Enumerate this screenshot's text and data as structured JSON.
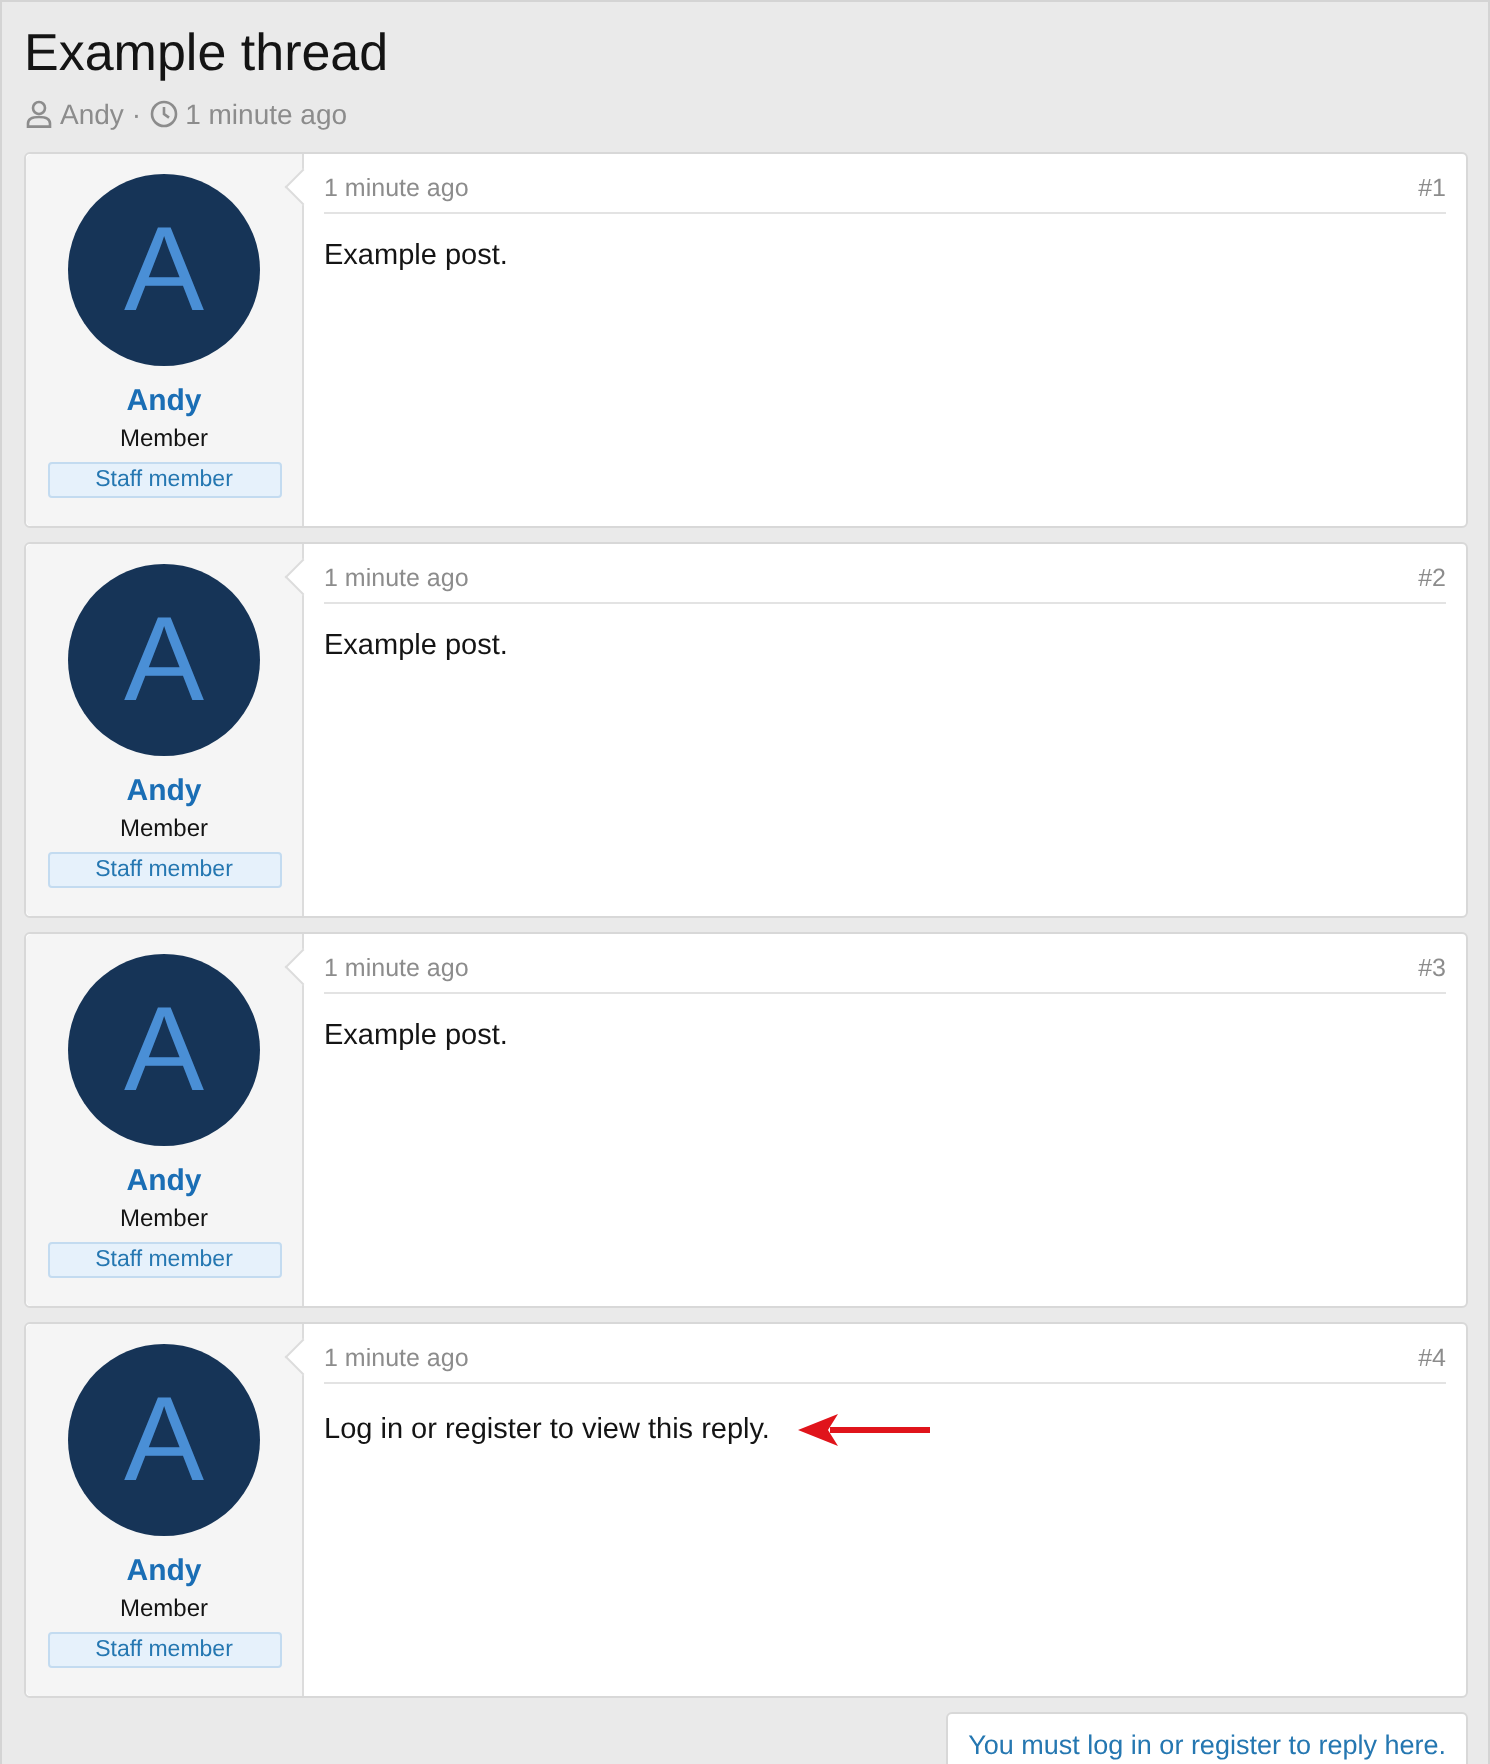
{
  "thread": {
    "title": "Example thread",
    "author": "Andy",
    "separator": "·",
    "time": "1 minute ago"
  },
  "posts": [
    {
      "avatar_letter": "A",
      "username": "Andy",
      "role": "Member",
      "badge": "Staff member",
      "time": "1 minute ago",
      "number": "#1",
      "body": "Example post.",
      "pointer_arrow": false
    },
    {
      "avatar_letter": "A",
      "username": "Andy",
      "role": "Member",
      "badge": "Staff member",
      "time": "1 minute ago",
      "number": "#2",
      "body": "Example post.",
      "pointer_arrow": false
    },
    {
      "avatar_letter": "A",
      "username": "Andy",
      "role": "Member",
      "badge": "Staff member",
      "time": "1 minute ago",
      "number": "#3",
      "body": "Example post.",
      "pointer_arrow": false
    },
    {
      "avatar_letter": "A",
      "username": "Andy",
      "role": "Member",
      "badge": "Staff member",
      "time": "1 minute ago",
      "number": "#4",
      "body": "Log in or register to view this reply.",
      "pointer_arrow": true
    }
  ],
  "reply_notice": "You must log in or register to reply here."
}
